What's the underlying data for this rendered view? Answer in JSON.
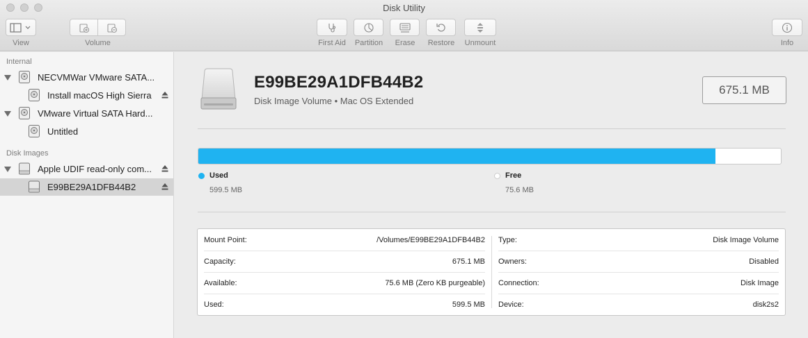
{
  "window": {
    "title": "Disk Utility"
  },
  "toolbar": {
    "view_label": "View",
    "volume_label": "Volume",
    "first_aid_label": "First Aid",
    "partition_label": "Partition",
    "erase_label": "Erase",
    "restore_label": "Restore",
    "unmount_label": "Unmount",
    "info_label": "Info"
  },
  "sidebar": {
    "internal_header": "Internal",
    "disk_images_header": "Disk Images",
    "items": [
      {
        "label": "NECVMWar VMware SATA...",
        "level": 0,
        "eject": false
      },
      {
        "label": "Install macOS High Sierra",
        "level": 1,
        "eject": true
      },
      {
        "label": "VMware Virtual SATA Hard...",
        "level": 0,
        "eject": false
      },
      {
        "label": "Untitled",
        "level": 1,
        "eject": false
      },
      {
        "label": "Apple UDIF read-only com...",
        "level": 0,
        "eject": true
      },
      {
        "label": "E99BE29A1DFB44B2",
        "level": 1,
        "eject": true,
        "selected": true
      }
    ]
  },
  "volume": {
    "name": "E99BE29A1DFB44B2",
    "subtitle": "Disk Image Volume • Mac OS Extended",
    "size": "675.1 MB"
  },
  "usage": {
    "used_fraction": 0.888,
    "used_label": "Used",
    "used_value": "599.5 MB",
    "free_label": "Free",
    "free_value": "75.6 MB",
    "used_color": "#1fb3f1",
    "free_color": "#ffffff"
  },
  "info": {
    "left": [
      {
        "key": "Mount Point:",
        "value": "/Volumes/E99BE29A1DFB44B2"
      },
      {
        "key": "Capacity:",
        "value": "675.1 MB"
      },
      {
        "key": "Available:",
        "value": "75.6 MB (Zero KB purgeable)"
      },
      {
        "key": "Used:",
        "value": "599.5 MB"
      }
    ],
    "right": [
      {
        "key": "Type:",
        "value": "Disk Image Volume"
      },
      {
        "key": "Owners:",
        "value": "Disabled"
      },
      {
        "key": "Connection:",
        "value": "Disk Image"
      },
      {
        "key": "Device:",
        "value": "disk2s2"
      }
    ]
  },
  "icons": {
    "view": "sidebar-view-icon",
    "first_aid": "stethoscope-icon",
    "partition": "pie-icon",
    "erase": "erase-icon",
    "restore": "restore-icon",
    "unmount": "unmount-icon",
    "info": "info-icon"
  }
}
